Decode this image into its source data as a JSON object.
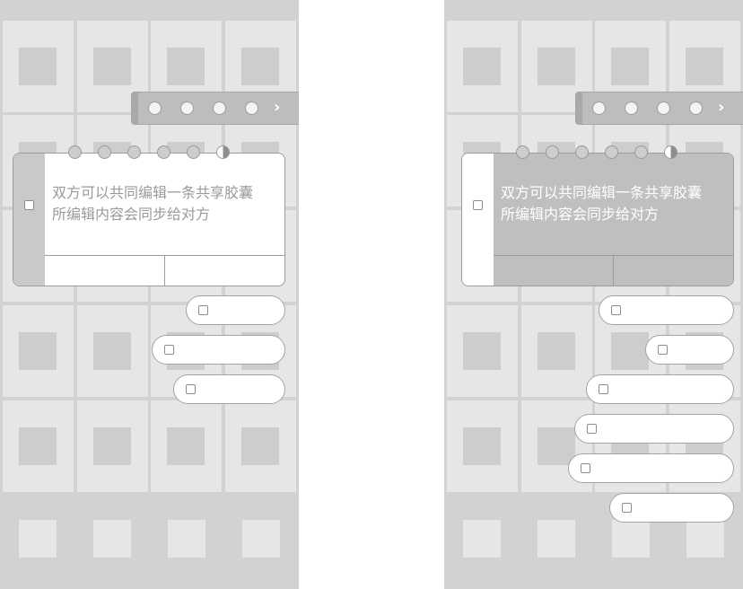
{
  "share_card": {
    "text_line1": "双方可以共同编辑一条共享胶囊",
    "text_line2": "所编辑内容会同步给对方"
  },
  "toolbar": {
    "next_glyph": "›"
  },
  "colors": {
    "background": "#d2d2d2",
    "tile": "#e6e6e6",
    "toolbar": "#bdbdbd",
    "card_selected": "#bfbfbf"
  }
}
